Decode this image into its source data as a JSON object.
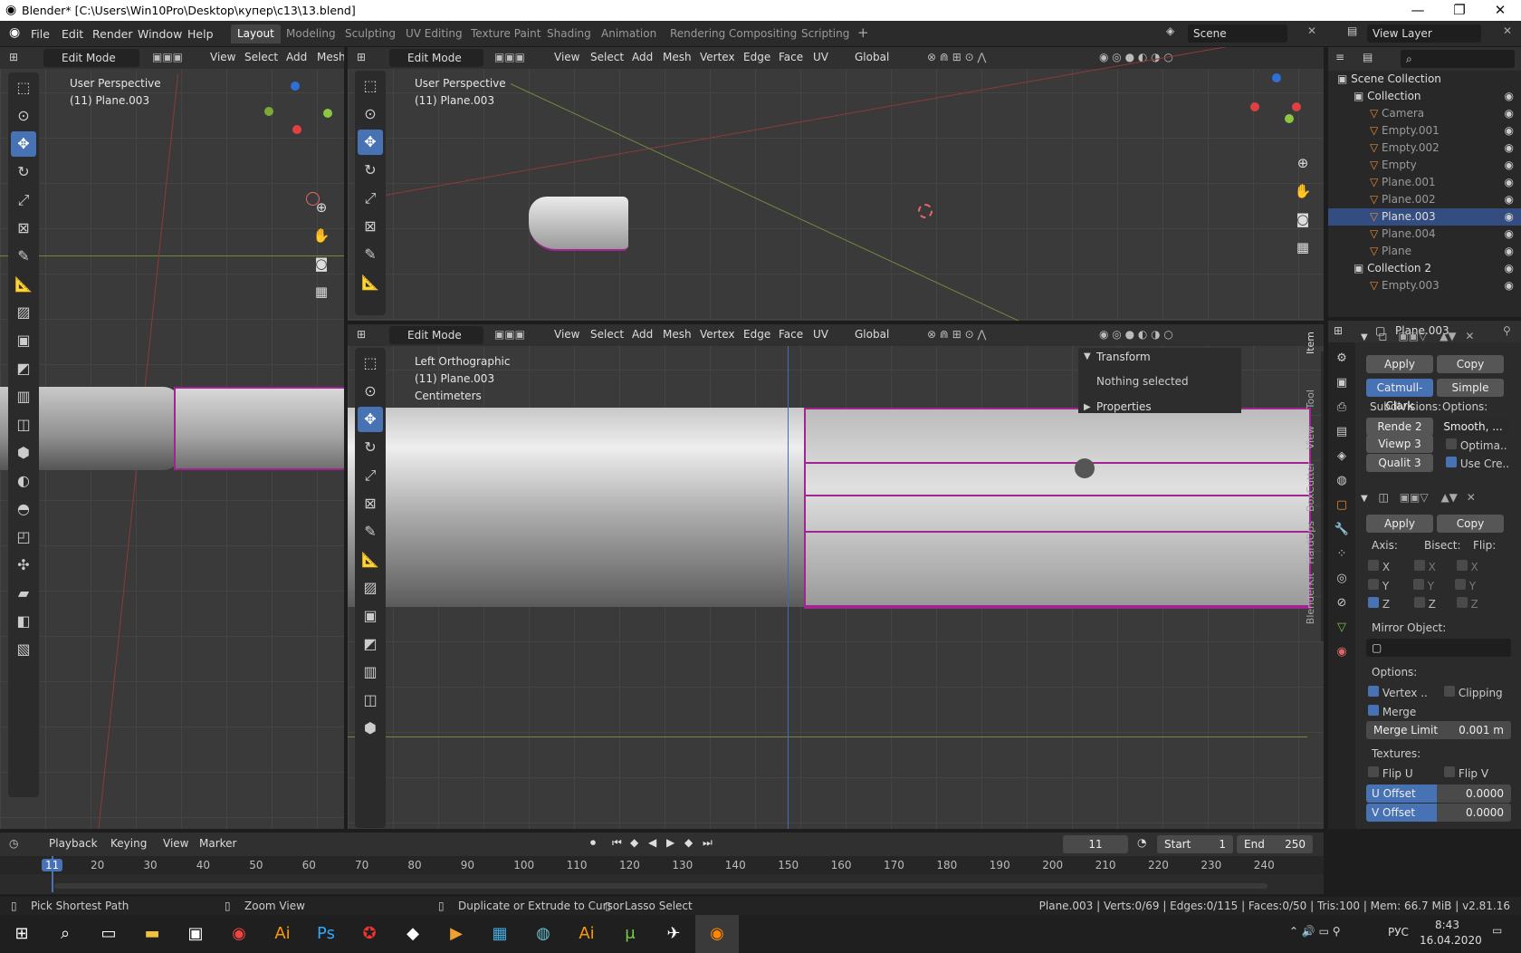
{
  "window": {
    "title": "Blender* [C:\\Users\\Win10Pro\\Desktop\\купер\\c13\\13.blend]"
  },
  "menus": [
    "File",
    "Edit",
    "Render",
    "Window",
    "Help"
  ],
  "workspaces": [
    "Layout",
    "Modeling",
    "Sculpting",
    "UV Editing",
    "Texture Paint",
    "Shading",
    "Animation",
    "Rendering",
    "Compositing",
    "Scripting"
  ],
  "scene": "Scene",
  "view_layer": "View Layer",
  "viewport_menu": [
    "View",
    "Select",
    "Add",
    "Mesh",
    "Vertex",
    "Edge",
    "Face",
    "UV"
  ],
  "mode": "Edit Mode",
  "orientation": "Global",
  "left_view": {
    "title": "User Perspective",
    "object": "(11) Plane.003",
    "menu": [
      "View",
      "Select",
      "Add",
      "Mesh"
    ]
  },
  "top_view": {
    "title": "User Perspective",
    "object": "(11) Plane.003"
  },
  "bottom_view": {
    "title": "Left Orthographic",
    "object": "(11) Plane.003",
    "units": "Centimeters"
  },
  "sidebar": {
    "transform": "Transform",
    "nothing": "Nothing selected",
    "properties": "Properties",
    "tabs": [
      "Item",
      "Tool",
      "View",
      "BoxCutter",
      "HardOps",
      "BlenderKit"
    ]
  },
  "outliner": {
    "rows": [
      {
        "label": "Scene Collection",
        "indent": 0
      },
      {
        "label": "Collection",
        "indent": 1
      },
      {
        "label": "Camera",
        "indent": 2
      },
      {
        "label": "Empty.001",
        "indent": 2
      },
      {
        "label": "Empty.002",
        "indent": 2
      },
      {
        "label": "Empty",
        "indent": 2
      },
      {
        "label": "Plane.001",
        "indent": 2
      },
      {
        "label": "Plane.002",
        "indent": 2
      },
      {
        "label": "Plane.003",
        "indent": 2,
        "selected": true
      },
      {
        "label": "Plane.004",
        "indent": 2
      },
      {
        "label": "Plane",
        "indent": 2
      },
      {
        "label": "Collection 2",
        "indent": 1
      },
      {
        "label": "Empty.003",
        "indent": 2
      }
    ]
  },
  "properties": {
    "object": "Plane.003",
    "apply": "Apply",
    "copy": "Copy",
    "catmull": "Catmull-Clark",
    "simple": "Simple",
    "subdivisions": "Subdivisions:",
    "options_lbl": "Options:",
    "render": "Rende",
    "render_val": "2",
    "viewport": "Viewp",
    "viewport_val": "3",
    "quality": "Qualit",
    "quality_val": "3",
    "smooth": "Smooth, ...",
    "optimal": "Optima..",
    "use_crease": "Use Cre..",
    "axis": "Axis:",
    "bisect": "Bisect:",
    "flip": "Flip:",
    "mirror_object": "Mirror Object:",
    "options": "Options:",
    "vertex": "Vertex ..",
    "clipping": "Clipping",
    "merge": "Merge",
    "merge_limit": "Merge Limit",
    "merge_limit_val": "0.001 m",
    "textures": "Textures:",
    "flip_u": "Flip U",
    "flip_v": "Flip V",
    "u_offset": "U Offset",
    "u_offset_val": "0.0000",
    "v_offset": "V Offset",
    "v_offset_val": "0.0000"
  },
  "timeline": {
    "menus": [
      "Playback",
      "Keying",
      "View",
      "Marker"
    ],
    "current": "11",
    "start_lbl": "Start",
    "start": "1",
    "end_lbl": "End",
    "end": "250",
    "ticks": [
      "11",
      "20",
      "30",
      "40",
      "50",
      "60",
      "70",
      "80",
      "90",
      "100",
      "110",
      "120",
      "130",
      "140",
      "150",
      "160",
      "170",
      "180",
      "190",
      "200",
      "210",
      "220",
      "230",
      "240"
    ]
  },
  "status": {
    "left1": "Pick Shortest Path",
    "left2": "Zoom View",
    "mid1": "Duplicate or Extrude to Cursor",
    "mid2": "Lasso Select",
    "right": "Plane.003 | Verts:0/69 | Edges:0/115 | Faces:0/50 | Tris:100 | Mem: 66.7 MiB | v2.81.16"
  },
  "taskbar": {
    "lang": "РУС",
    "time": "8:43",
    "date": "16.04.2020"
  }
}
